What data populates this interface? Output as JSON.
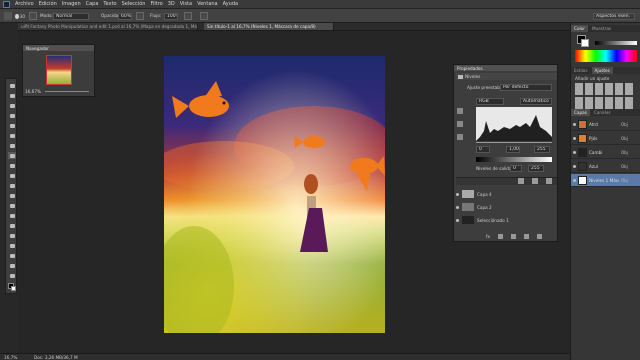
{
  "menu": [
    "Archivo",
    "Edición",
    "Imagen",
    "Capa",
    "Texto",
    "Selección",
    "Filtro",
    "3D",
    "Vista",
    "Ventana",
    "Ayuda"
  ],
  "options": {
    "mode_label": "Modo:",
    "mode_value": "Normal",
    "opacity_label": "Opacidad:",
    "opacity_value": "60%",
    "flow_label": "Flujo:",
    "flow_value": "100%",
    "brush_size": "30",
    "workspace": "Aspectos esen."
  },
  "tabs": [
    "uiflt Fantasy Photo Manipulation and edit 1.psd al 16,7% (Mapa en degradado 1, Máscara de capa/8)",
    "Sin título-1 al 16,7% (Niveles 1, Máscara de capa/8)"
  ],
  "navigator": {
    "title": "Navegador",
    "zoom": "16,67%"
  },
  "dock": {
    "color_tabs": [
      "Color",
      "Muestras"
    ],
    "adjust_tabs": [
      "Estilos",
      "Ajustes"
    ],
    "adjust_title": "Añadir un ajuste",
    "layers_tabs": [
      "Capas",
      "Canales"
    ],
    "layers": [
      {
        "name": "Atrd",
        "extra": "Obj"
      },
      {
        "name": "Pjós",
        "extra": "Obj"
      },
      {
        "name": "Cambi",
        "extra": "Obj"
      },
      {
        "name": "Azul",
        "extra": "Obj"
      },
      {
        "name": "Niveles 1 Máscara",
        "extra": "Obj"
      }
    ]
  },
  "properties": {
    "title": "Propiedades",
    "section": "Niveles",
    "preset_label": "Ajuste preestablecido:",
    "preset_value": "Por defecto",
    "channel": "RGB",
    "auto": "Automático",
    "input_black": "0",
    "input_mid": "1,00",
    "input_white": "255",
    "output_label": "Niveles de salida:",
    "output_black": "0",
    "output_white": "255",
    "bottom_icons": "fx"
  },
  "layers_list": [
    {
      "name": "Capa 4"
    },
    {
      "name": "Capa 2"
    },
    {
      "name": "Selecciónado 1"
    }
  ],
  "status": {
    "zoom": "16,7%",
    "doc": "Doc: 3,26 MB/36,7 M"
  },
  "colors": {
    "accent": "#5b7aa8",
    "bg": "#282828",
    "panel": "#3d3d3d"
  }
}
